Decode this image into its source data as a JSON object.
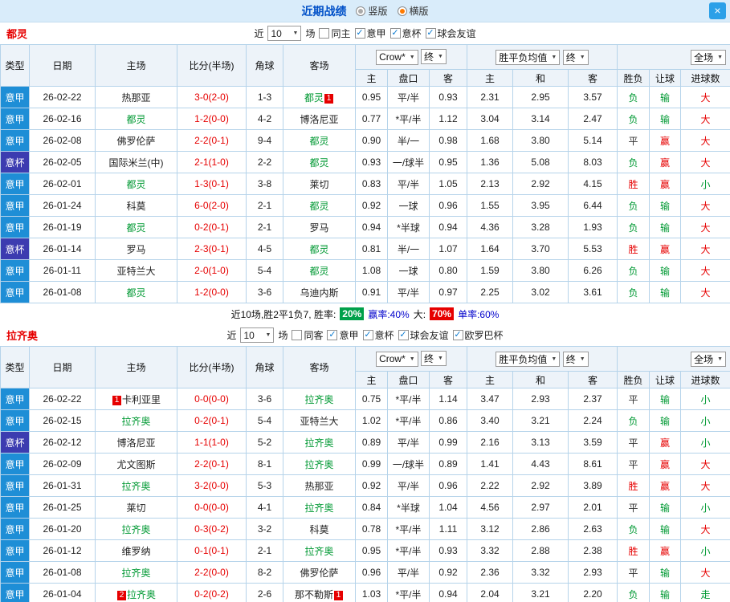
{
  "header": {
    "title": "近期战绩",
    "radio_vertical": "竖版",
    "radio_horizontal": "横版",
    "close": "×"
  },
  "colors": {
    "league_blue": "#1e8ed6",
    "cup_blue": "#3c3cb0",
    "win_red": "#e60000",
    "lose_green": "#009933",
    "topbar_bg": "#d9ecfa",
    "table_border": "#b5d3ea"
  },
  "columns": {
    "type": "类型",
    "date": "日期",
    "home": "主场",
    "score": "比分(半场)",
    "corner": "角球",
    "away": "客场",
    "odds_source": "Crow*",
    "final": "终",
    "avg": "胜平负均值",
    "full": "全场",
    "sub": {
      "h": "主",
      "hcp": "盘口",
      "a": "客",
      "d": "和",
      "res": "胜负",
      "let": "让球",
      "goal": "进球数"
    }
  },
  "sections": [
    {
      "team": "都灵",
      "filters": {
        "near": "近",
        "count": "10",
        "games": "场",
        "checkboxes": [
          {
            "label": "同主",
            "checked": false
          },
          {
            "label": "意甲",
            "checked": true
          },
          {
            "label": "意杯",
            "checked": true
          },
          {
            "label": "球会友谊",
            "checked": true
          }
        ]
      },
      "rows": [
        {
          "type": "意甲",
          "tc": "jia",
          "date": "26-02-22",
          "home": {
            "name": "热那亚"
          },
          "score": "3-0(2-0)",
          "corner": "1-3",
          "away": {
            "name": "都灵",
            "green": true,
            "post": "1"
          },
          "o": [
            "0.95",
            "平/半",
            "0.93"
          ],
          "m": [
            "2.31",
            "2.95",
            "3.57"
          ],
          "res": [
            "负",
            "g"
          ],
          "let": [
            "输",
            "g"
          ],
          "goal": [
            "大",
            "r"
          ]
        },
        {
          "type": "意甲",
          "tc": "jia",
          "date": "26-02-16",
          "home": {
            "name": "都灵",
            "green": true
          },
          "score": "1-2(0-0)",
          "corner": "4-2",
          "away": {
            "name": "博洛尼亚"
          },
          "o": [
            "0.77",
            "*平/半",
            "1.12"
          ],
          "m": [
            "3.04",
            "3.14",
            "2.47"
          ],
          "res": [
            "负",
            "g"
          ],
          "let": [
            "输",
            "g"
          ],
          "goal": [
            "大",
            "r"
          ]
        },
        {
          "type": "意甲",
          "tc": "jia",
          "date": "26-02-08",
          "home": {
            "name": "佛罗伦萨"
          },
          "score": "2-2(0-1)",
          "corner": "9-4",
          "away": {
            "name": "都灵",
            "green": true
          },
          "o": [
            "0.90",
            "半/一",
            "0.98"
          ],
          "m": [
            "1.68",
            "3.80",
            "5.14"
          ],
          "res": [
            "平",
            "k"
          ],
          "let": [
            "赢",
            "r"
          ],
          "goal": [
            "大",
            "r"
          ]
        },
        {
          "type": "意杯",
          "tc": "bei",
          "date": "26-02-05",
          "home": {
            "name": "国际米兰(中)"
          },
          "score": "2-1(1-0)",
          "corner": "2-2",
          "away": {
            "name": "都灵",
            "green": true
          },
          "o": [
            "0.93",
            "一/球半",
            "0.95"
          ],
          "m": [
            "1.36",
            "5.08",
            "8.03"
          ],
          "res": [
            "负",
            "g"
          ],
          "let": [
            "赢",
            "r"
          ],
          "goal": [
            "大",
            "r"
          ]
        },
        {
          "type": "意甲",
          "tc": "jia",
          "date": "26-02-01",
          "home": {
            "name": "都灵",
            "green": true
          },
          "score": "1-3(0-1)",
          "corner": "3-8",
          "away": {
            "name": "莱切"
          },
          "o": [
            "0.83",
            "平/半",
            "1.05"
          ],
          "m": [
            "2.13",
            "2.92",
            "4.15"
          ],
          "res": [
            "胜",
            "r"
          ],
          "let": [
            "赢",
            "r"
          ],
          "goal": [
            "小",
            "g"
          ]
        },
        {
          "type": "意甲",
          "tc": "jia",
          "date": "26-01-24",
          "home": {
            "name": "科莫"
          },
          "score": "6-0(2-0)",
          "corner": "2-1",
          "away": {
            "name": "都灵",
            "green": true
          },
          "o": [
            "0.92",
            "一球",
            "0.96"
          ],
          "m": [
            "1.55",
            "3.95",
            "6.44"
          ],
          "res": [
            "负",
            "g"
          ],
          "let": [
            "输",
            "g"
          ],
          "goal": [
            "大",
            "r"
          ]
        },
        {
          "type": "意甲",
          "tc": "jia",
          "date": "26-01-19",
          "home": {
            "name": "都灵",
            "green": true
          },
          "score": "0-2(0-1)",
          "corner": "2-1",
          "away": {
            "name": "罗马"
          },
          "o": [
            "0.94",
            "*半球",
            "0.94"
          ],
          "m": [
            "4.36",
            "3.28",
            "1.93"
          ],
          "res": [
            "负",
            "g"
          ],
          "let": [
            "输",
            "g"
          ],
          "goal": [
            "大",
            "r"
          ]
        },
        {
          "type": "意杯",
          "tc": "bei",
          "date": "26-01-14",
          "home": {
            "name": "罗马"
          },
          "score": "2-3(0-1)",
          "corner": "4-5",
          "away": {
            "name": "都灵",
            "green": true
          },
          "o": [
            "0.81",
            "半/一",
            "1.07"
          ],
          "m": [
            "1.64",
            "3.70",
            "5.53"
          ],
          "res": [
            "胜",
            "r"
          ],
          "let": [
            "赢",
            "r"
          ],
          "goal": [
            "大",
            "r"
          ]
        },
        {
          "type": "意甲",
          "tc": "jia",
          "date": "26-01-11",
          "home": {
            "name": "亚特兰大"
          },
          "score": "2-0(1-0)",
          "corner": "5-4",
          "away": {
            "name": "都灵",
            "green": true
          },
          "o": [
            "1.08",
            "一球",
            "0.80"
          ],
          "m": [
            "1.59",
            "3.80",
            "6.26"
          ],
          "res": [
            "负",
            "g"
          ],
          "let": [
            "输",
            "g"
          ],
          "goal": [
            "大",
            "r"
          ]
        },
        {
          "type": "意甲",
          "tc": "jia",
          "date": "26-01-08",
          "home": {
            "name": "都灵",
            "green": true
          },
          "score": "1-2(0-0)",
          "corner": "3-6",
          "away": {
            "name": "乌迪内斯"
          },
          "o": [
            "0.91",
            "平/半",
            "0.97"
          ],
          "m": [
            "2.25",
            "3.02",
            "3.61"
          ],
          "res": [
            "负",
            "g"
          ],
          "let": [
            "输",
            "g"
          ],
          "goal": [
            "大",
            "r"
          ]
        }
      ],
      "summary": {
        "prefix": "近10场,胜2平1负7, 胜率:",
        "win_rate": "20%",
        "mid": "赢率:40%",
        "big_label": "大:",
        "big_rate": "70%",
        "tail": "单率:60%"
      }
    },
    {
      "team": "拉齐奥",
      "filters": {
        "near": "近",
        "count": "10",
        "games": "场",
        "checkboxes": [
          {
            "label": "同客",
            "checked": false
          },
          {
            "label": "意甲",
            "checked": true
          },
          {
            "label": "意杯",
            "checked": true
          },
          {
            "label": "球会友谊",
            "checked": true
          },
          {
            "label": "欧罗巴杯",
            "checked": true
          }
        ]
      },
      "rows": [
        {
          "type": "意甲",
          "tc": "jia",
          "date": "26-02-22",
          "home": {
            "pre": "1",
            "name": "卡利亚里"
          },
          "score": "0-0(0-0)",
          "corner": "3-6",
          "away": {
            "name": "拉齐奥",
            "green": true
          },
          "o": [
            "0.75",
            "*平/半",
            "1.14"
          ],
          "m": [
            "3.47",
            "2.93",
            "2.37"
          ],
          "res": [
            "平",
            "k"
          ],
          "let": [
            "输",
            "g"
          ],
          "goal": [
            "小",
            "g"
          ]
        },
        {
          "type": "意甲",
          "tc": "jia",
          "date": "26-02-15",
          "home": {
            "name": "拉齐奥",
            "green": true
          },
          "score": "0-2(0-1)",
          "corner": "5-4",
          "away": {
            "name": "亚特兰大"
          },
          "o": [
            "1.02",
            "*平/半",
            "0.86"
          ],
          "m": [
            "3.40",
            "3.21",
            "2.24"
          ],
          "res": [
            "负",
            "g"
          ],
          "let": [
            "输",
            "g"
          ],
          "goal": [
            "小",
            "g"
          ]
        },
        {
          "type": "意杯",
          "tc": "bei",
          "date": "26-02-12",
          "home": {
            "name": "博洛尼亚"
          },
          "score": "1-1(1-0)",
          "corner": "5-2",
          "away": {
            "name": "拉齐奥",
            "green": true
          },
          "o": [
            "0.89",
            "平/半",
            "0.99"
          ],
          "m": [
            "2.16",
            "3.13",
            "3.59"
          ],
          "res": [
            "平",
            "k"
          ],
          "let": [
            "赢",
            "r"
          ],
          "goal": [
            "小",
            "g"
          ]
        },
        {
          "type": "意甲",
          "tc": "jia",
          "date": "26-02-09",
          "home": {
            "name": "尤文图斯"
          },
          "score": "2-2(0-1)",
          "corner": "8-1",
          "away": {
            "name": "拉齐奥",
            "green": true
          },
          "o": [
            "0.99",
            "一/球半",
            "0.89"
          ],
          "m": [
            "1.41",
            "4.43",
            "8.61"
          ],
          "res": [
            "平",
            "k"
          ],
          "let": [
            "赢",
            "r"
          ],
          "goal": [
            "大",
            "r"
          ]
        },
        {
          "type": "意甲",
          "tc": "jia",
          "date": "26-01-31",
          "home": {
            "name": "拉齐奥",
            "green": true
          },
          "score": "3-2(0-0)",
          "corner": "5-3",
          "away": {
            "name": "热那亚"
          },
          "o": [
            "0.92",
            "平/半",
            "0.96"
          ],
          "m": [
            "2.22",
            "2.92",
            "3.89"
          ],
          "res": [
            "胜",
            "r"
          ],
          "let": [
            "赢",
            "r"
          ],
          "goal": [
            "大",
            "r"
          ]
        },
        {
          "type": "意甲",
          "tc": "jia",
          "date": "26-01-25",
          "home": {
            "name": "莱切"
          },
          "score": "0-0(0-0)",
          "corner": "4-1",
          "away": {
            "name": "拉齐奥",
            "green": true
          },
          "o": [
            "0.84",
            "*半球",
            "1.04"
          ],
          "m": [
            "4.56",
            "2.97",
            "2.01"
          ],
          "res": [
            "平",
            "k"
          ],
          "let": [
            "输",
            "g"
          ],
          "goal": [
            "小",
            "g"
          ]
        },
        {
          "type": "意甲",
          "tc": "jia",
          "date": "26-01-20",
          "home": {
            "name": "拉齐奥",
            "green": true
          },
          "score": "0-3(0-2)",
          "corner": "3-2",
          "away": {
            "name": "科莫"
          },
          "o": [
            "0.78",
            "*平/半",
            "1.11"
          ],
          "m": [
            "3.12",
            "2.86",
            "2.63"
          ],
          "res": [
            "负",
            "g"
          ],
          "let": [
            "输",
            "g"
          ],
          "goal": [
            "大",
            "r"
          ]
        },
        {
          "type": "意甲",
          "tc": "jia",
          "date": "26-01-12",
          "home": {
            "name": "维罗纳"
          },
          "score": "0-1(0-1)",
          "corner": "2-1",
          "away": {
            "name": "拉齐奥",
            "green": true
          },
          "o": [
            "0.95",
            "*平/半",
            "0.93"
          ],
          "m": [
            "3.32",
            "2.88",
            "2.38"
          ],
          "res": [
            "胜",
            "r"
          ],
          "let": [
            "赢",
            "r"
          ],
          "goal": [
            "小",
            "g"
          ]
        },
        {
          "type": "意甲",
          "tc": "jia",
          "date": "26-01-08",
          "home": {
            "name": "拉齐奥",
            "green": true
          },
          "score": "2-2(0-0)",
          "corner": "8-2",
          "away": {
            "name": "佛罗伦萨"
          },
          "o": [
            "0.96",
            "平/半",
            "0.92"
          ],
          "m": [
            "2.36",
            "3.32",
            "2.93"
          ],
          "res": [
            "平",
            "k"
          ],
          "let": [
            "输",
            "g"
          ],
          "goal": [
            "大",
            "r"
          ]
        },
        {
          "type": "意甲",
          "tc": "jia",
          "date": "26-01-04",
          "home": {
            "pre": "2",
            "name": "拉齐奥",
            "green": true
          },
          "score": "0-2(0-2)",
          "corner": "2-6",
          "away": {
            "name": "那不勒斯",
            "post": "1"
          },
          "o": [
            "1.03",
            "*平/半",
            "0.94"
          ],
          "m": [
            "2.04",
            "3.21",
            "2.20"
          ],
          "res": [
            "负",
            "g"
          ],
          "let": [
            "输",
            "g"
          ],
          "goal": [
            "走",
            "g"
          ]
        }
      ]
    }
  ]
}
